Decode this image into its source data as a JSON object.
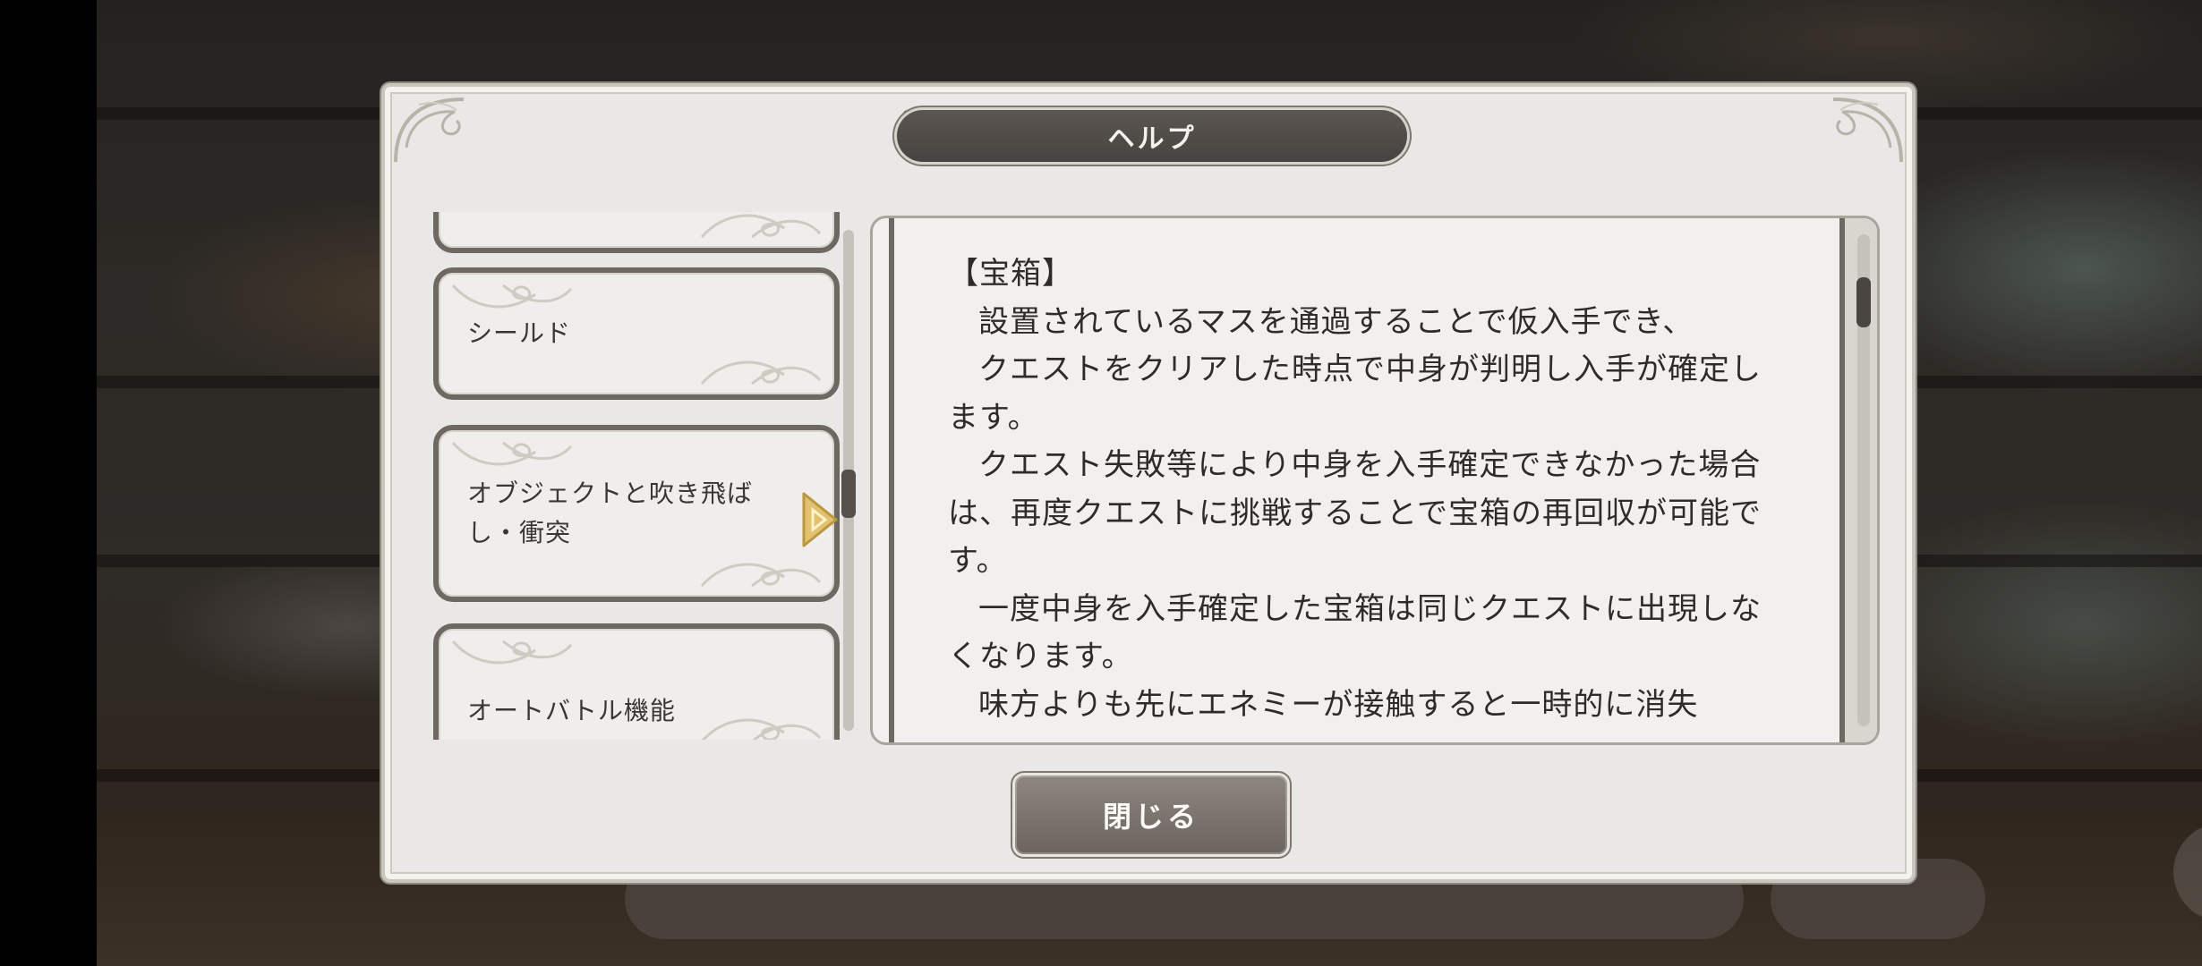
{
  "dialog": {
    "title": "ヘルプ",
    "close_label": "閉じる"
  },
  "topics": [
    {
      "label": ""
    },
    {
      "label": "シールド"
    },
    {
      "label": "オブジェクトと吹き飛ばし・衝突",
      "selected": true
    },
    {
      "label": "オートバトル機能"
    }
  ],
  "content": {
    "heading": "【宝箱】",
    "paragraphs": [
      "設置されているマスを通過することで仮入手でき、",
      "クエストをクリアした時点で中身が判明し入手が確定します。",
      "クエスト失敗等により中身を入手確定できなかった場合は、再度クエストに挑戦することで宝箱の再回収が可能です。",
      "一度中身を入手確定した宝箱は同じクエストに出現しなくなります。",
      "味方よりも先にエネミーが接触すると一時的に消失"
    ]
  },
  "colors": {
    "card_border": "#6e6863",
    "title_bar": "#4e4a46",
    "close_button": "#7c756e",
    "selected_arrow": "#e2c271"
  }
}
